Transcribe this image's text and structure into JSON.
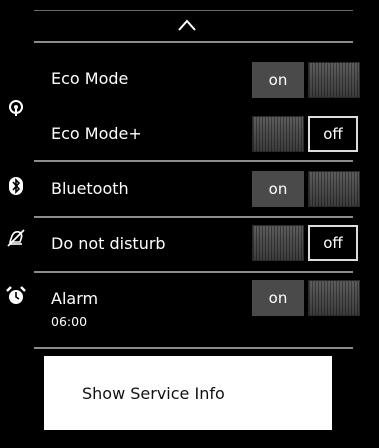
{
  "settings": {
    "eco_mode": {
      "label": "Eco Mode",
      "state": "on",
      "icon": "eco-icon"
    },
    "eco_mode_plus": {
      "label": "Eco Mode+",
      "state": "off"
    },
    "bluetooth": {
      "label": "Bluetooth",
      "state": "on",
      "icon": "bluetooth-icon"
    },
    "do_not_disturb": {
      "label": "Do not disturb",
      "state": "off",
      "icon": "bell-off-icon"
    },
    "alarm": {
      "label": "Alarm",
      "time": "06:00",
      "state": "on",
      "icon": "alarm-clock-icon"
    }
  },
  "service_button": {
    "label": "Show Service Info"
  },
  "collapse": {
    "icon": "chevron-up-icon"
  }
}
